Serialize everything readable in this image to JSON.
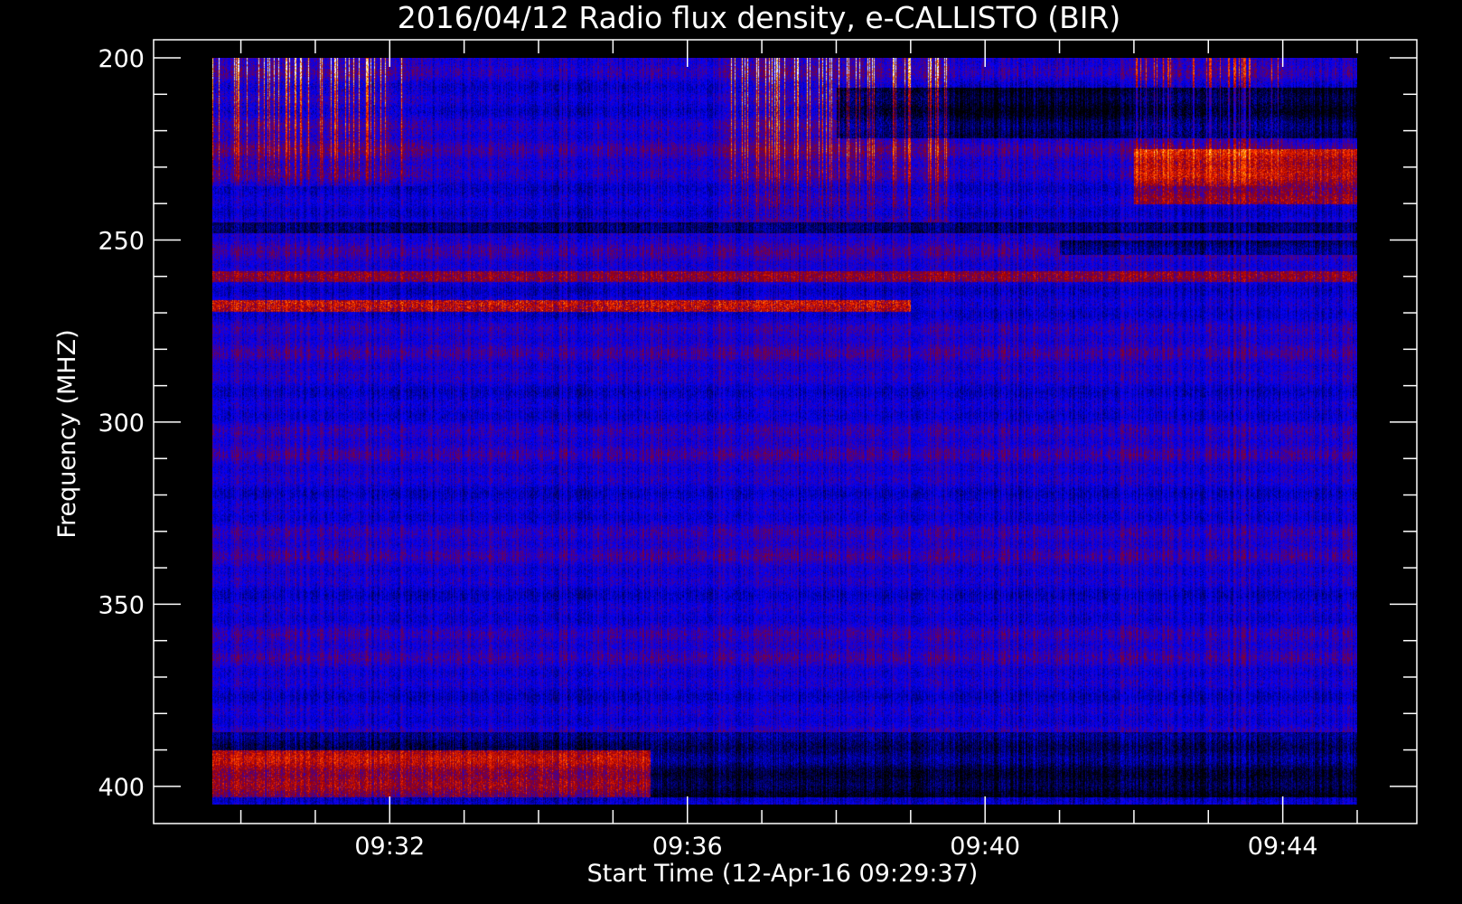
{
  "chart_data": {
    "type": "heatmap",
    "title": "2016/04/12  Radio flux density, e-CALLISTO (BIR)",
    "xlabel": "Start Time (12-Apr-16 09:29:37)",
    "ylabel": "Frequency (MHZ)",
    "x_axis": {
      "unit": "time",
      "range": [
        "09:29:37",
        "09:45:00"
      ],
      "major_ticks": [
        "09:32",
        "09:36",
        "09:40",
        "09:44"
      ],
      "minor_tick_minutes": 1
    },
    "y_axis": {
      "unit": "MHz",
      "range": [
        200,
        405
      ],
      "inverted": true,
      "major_ticks": [
        200,
        250,
        300,
        350,
        400
      ],
      "minor_tick_step": 10
    },
    "colormap": [
      "#000000",
      "#0000ff",
      "#a00000",
      "#ff3000",
      "#ffb000",
      "#ffffff"
    ],
    "background_level": "blue",
    "features": [
      {
        "kind": "burst_cluster",
        "time": [
          "09:29:37",
          "09:32:30"
        ],
        "freq": [
          200,
          235
        ],
        "intensity": "high"
      },
      {
        "kind": "burst_cluster",
        "time": [
          "09:36:30",
          "09:39:30"
        ],
        "freq": [
          200,
          245
        ],
        "intensity": "high"
      },
      {
        "kind": "burst_cluster",
        "time": [
          "09:42:00",
          "09:44:00"
        ],
        "freq": [
          200,
          235
        ],
        "intensity": "medium"
      },
      {
        "kind": "enhanced_band",
        "time": [
          "09:42:00",
          "09:45:00"
        ],
        "freq": [
          225,
          240
        ],
        "intensity": "medium"
      },
      {
        "kind": "interference_band",
        "freq": 268,
        "time": [
          "09:29:37",
          "09:39:00"
        ],
        "intensity": "medium"
      },
      {
        "kind": "interference_band",
        "freq": 260,
        "time": [
          "09:29:37",
          "09:45:00"
        ],
        "intensity": "low"
      },
      {
        "kind": "dark_band",
        "freq": [
          245,
          248
        ],
        "time": [
          "09:29:37",
          "09:45:00"
        ]
      },
      {
        "kind": "dark_band",
        "freq": [
          250,
          254
        ],
        "time": [
          "09:41:00",
          "09:45:00"
        ]
      },
      {
        "kind": "dark_band",
        "freq": [
          208,
          222
        ],
        "time": [
          "09:38:00",
          "09:45:00"
        ]
      },
      {
        "kind": "dark_band",
        "freq": [
          385,
          390
        ],
        "time": [
          "09:29:37",
          "09:45:00"
        ]
      },
      {
        "kind": "dark_band",
        "freq": [
          390,
          403
        ],
        "time": [
          "09:35:30",
          "09:45:00"
        ]
      },
      {
        "kind": "enhanced_band",
        "time": [
          "09:29:37",
          "09:35:30"
        ],
        "freq": [
          390,
          403
        ],
        "intensity": "medium"
      }
    ]
  }
}
